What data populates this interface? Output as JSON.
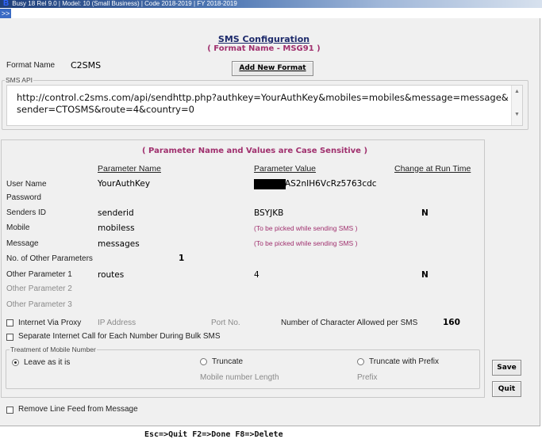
{
  "topbar": {
    "text": "Busy 18 Rel 9.0  |  Model: 10 (Small Business)  |  Code 2018-2019  |  FY 2018-2019"
  },
  "expand_label": ">>",
  "title": "SMS Configuration",
  "subtitle": "( Format Name - MSG91 )",
  "format_name_label": "Format Name",
  "format_name_value": "C2SMS",
  "add_new_format_label": "Add New Format",
  "sms_api": {
    "legend": "SMS API",
    "url": "http://control.c2sms.com/api/sendhttp.php?authkey=YourAuthKey&mobiles=mobiles&message=message&sender=CTOSMS&route=4&country=0"
  },
  "params": {
    "caption": "( Parameter Name and Values are Case Sensitive )",
    "col_name": "Parameter Name",
    "col_value": "Parameter Value",
    "col_change": "Change at Run Time",
    "rows": [
      {
        "label": "User Name",
        "name": "YourAuthKey",
        "value": "AS2nIH6VcRz5763cdc",
        "change": "",
        "dim": false
      },
      {
        "label": "Password",
        "name": "",
        "value": "",
        "change": "",
        "dim": false
      },
      {
        "label": "Senders ID",
        "name": "senderid",
        "value": "BSYJKB",
        "change": "N",
        "dim": false
      },
      {
        "label": "Mobile",
        "name": "mobiless",
        "value": "(To be picked while sending SMS )",
        "change": "",
        "dim": false
      },
      {
        "label": "Message",
        "name": "messages",
        "value": "(To be picked while sending SMS )",
        "change": "",
        "dim": false
      },
      {
        "label": "No. of Other Parameters",
        "name": "1",
        "value": "",
        "change": "",
        "dim": false
      },
      {
        "label": "Other Parameter 1",
        "name": "routes",
        "value": "4",
        "change": "N",
        "dim": false
      },
      {
        "label": "Other Parameter 2",
        "name": "",
        "value": "",
        "change": "",
        "dim": true
      },
      {
        "label": "Other Parameter 3",
        "name": "",
        "value": "",
        "change": "",
        "dim": true
      }
    ]
  },
  "internet_via_proxy": "Internet Via Proxy",
  "ip_address": "IP Address",
  "port_no": "Port No.",
  "char_allowed_label": "Number of Character Allowed per SMS",
  "char_allowed_value": "160",
  "separate_call": "Separate Internet Call for Each Number During Bulk SMS",
  "treatment": {
    "legend": "Treatment of Mobile Number",
    "leave": "Leave as it is",
    "truncate": "Truncate",
    "truncate_prefix": "Truncate with Prefix",
    "mobile_length": "Mobile number Length",
    "prefix": "Prefix",
    "selected": "leave"
  },
  "save_label": "Save",
  "quit_label": "Quit",
  "remove_line_feed": "Remove Line Feed from Message",
  "shortcuts": "Esc=>Quit  F2=>Done  F8=>Delete"
}
